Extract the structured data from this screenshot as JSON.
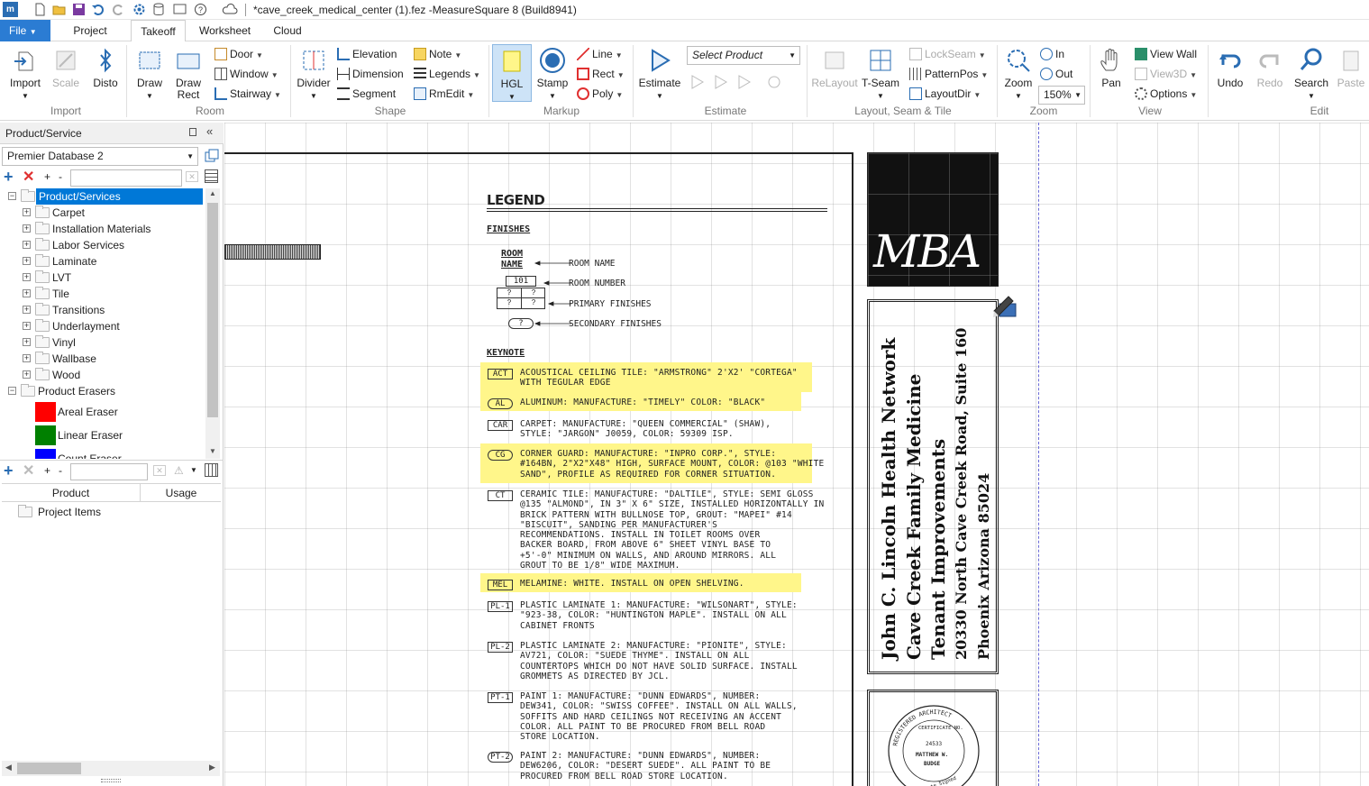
{
  "window": {
    "title": "*cave_creek_medical_center (1).fez -MeasureSquare 8 (Build8941)",
    "app_logo": "m"
  },
  "menu": {
    "file": "File",
    "tabs": [
      "Project Info",
      "Takeoff",
      "Worksheet",
      "Cloud"
    ],
    "active": "Takeoff"
  },
  "ribbon": {
    "import": {
      "import": "Import",
      "scale": "Scale",
      "disto": "Disto",
      "group": "Import"
    },
    "room": {
      "draw": "Draw",
      "draw_rect": "Draw Rect",
      "door": "Door",
      "window": "Window",
      "stairway": "Stairway",
      "group": "Room"
    },
    "shape": {
      "divider": "Divider",
      "elevation": "Elevation",
      "dimension": "Dimension",
      "segment": "Segment",
      "note": "Note",
      "legends": "Legends",
      "rmedit": "RmEdit",
      "group": "Shape"
    },
    "markup": {
      "hgl": "HGL",
      "stamp": "Stamp",
      "line": "Line",
      "rect": "Rect",
      "poly": "Poly",
      "group": "Markup"
    },
    "estimate": {
      "estimate": "Estimate",
      "select_product": "Select Product",
      "group": "Estimate"
    },
    "layout": {
      "relayout": "ReLayout",
      "tseam": "T-Seam",
      "lockseam": "LockSeam",
      "patternpos": "PatternPos",
      "layoutdir": "LayoutDir",
      "group": "Layout, Seam & Tile"
    },
    "zoom": {
      "zoom": "Zoom",
      "in": "In",
      "out": "Out",
      "level": "150%",
      "group": "Zoom"
    },
    "view": {
      "pan": "Pan",
      "view_wall": "View Wall",
      "view3d": "View3D",
      "options": "Options",
      "group": "View"
    },
    "edit": {
      "undo": "Undo",
      "redo": "Redo",
      "search": "Search",
      "paste": "Paste",
      "group": "Edit"
    }
  },
  "left_panel": {
    "title": "Product/Service",
    "database": "Premier Database 2",
    "tree_root": "Product/Services",
    "categories": [
      "Carpet",
      "Installation Materials",
      "Labor Services",
      "Laminate",
      "LVT",
      "Tile",
      "Transitions",
      "Underlayment",
      "Vinyl",
      "Wallbase",
      "Wood"
    ],
    "erasers_root": "Product Erasers",
    "erasers": [
      {
        "label": "Areal Eraser",
        "color": "#ff0000"
      },
      {
        "label": "Linear Eraser",
        "color": "#008000"
      },
      {
        "label": "Count Eraser",
        "color": "#0000ff"
      }
    ],
    "product_table": {
      "columns": [
        "Product",
        "Usage"
      ],
      "root": "Project Items"
    }
  },
  "drawing": {
    "legend_title": "LEGEND",
    "finishes_title": "FINISHES",
    "room_name_label": "ROOM\nNAME",
    "room_number_value": "101",
    "finish_placeholders": [
      "?",
      "?",
      "?",
      "?"
    ],
    "secondary_placeholder": "?",
    "callouts": [
      "ROOM NAME",
      "ROOM NUMBER",
      "PRIMARY FINISHES",
      "SECONDARY FINISHES"
    ],
    "keynote_title": "KEYNOTE",
    "keynotes": [
      {
        "tag": "ACT",
        "text": "ACOUSTICAL CEILING TILE: \"ARMSTRONG\" 2'X2' \"CORTEGA\"\nWITH TEGULAR EDGE",
        "highlight": true
      },
      {
        "tag": "AL",
        "text": "ALUMINUM: MANUFACTURE: \"TIMELY\" COLOR: \"BLACK\"",
        "highlight": true
      },
      {
        "tag": "CAR",
        "text": "CARPET: MANUFACTURE: \"QUEEN COMMERCIAL\" (SHAW),\nSTYLE: \"JARGON\" J0059, COLOR: 59309 ISP.",
        "highlight": false
      },
      {
        "tag": "CG",
        "text": "CORNER GUARD: MANUFACTURE: \"INPRO CORP.\", STYLE:\n#164BN, 2\"X2\"X48\" HIGH, SURFACE MOUNT, COLOR: @103 \"WHITE\nSAND\", PROFILE AS REQUIRED FOR CORNER SITUATION.",
        "highlight": true
      },
      {
        "tag": "CT",
        "text": "CERAMIC TILE: MANUFACTURE: \"DALTILE\", STYLE: SEMI GLOSS\n@135 \"ALMOND\", IN 3\" X 6\" SIZE, INSTALLED HORIZONTALLY IN\nBRICK PATTERN WITH BULLNOSE TOP, GROUT: \"MAPEI\" #14\n\"BISCUIT\", SANDING PER MANUFACTURER'S\nRECOMMENDATIONS. INSTALL IN TOILET ROOMS OVER\nBACKER BOARD, FROM ABOVE 6\" SHEET VINYL BASE TO\n+5'-0\" MINIMUM ON WALLS, AND AROUND MIRRORS. ALL\nGROUT TO BE 1/8\" WIDE MAXIMUM.",
        "highlight": false
      },
      {
        "tag": "MEL",
        "text": "MELAMINE: WHITE. INSTALL ON OPEN SHELVING.",
        "highlight": true
      },
      {
        "tag": "PL-1",
        "text": "PLASTIC LAMINATE 1: MANUFACTURE: \"WILSONART\", STYLE:\n\"923-38, COLOR: \"HUNTINGTON MAPLE\". INSTALL ON ALL\nCABINET FRONTS",
        "highlight": false
      },
      {
        "tag": "PL-2",
        "text": "PLASTIC LAMINATE 2: MANUFACTURE: \"PIONITE\", STYLE:\nAV721, COLOR: \"SUEDE THYME\". INSTALL ON ALL\nCOUNTERTOPS WHICH DO NOT HAVE SOLID SURFACE. INSTALL\nGROMMETS AS DIRECTED BY JCL.",
        "highlight": false
      },
      {
        "tag": "PT-1",
        "text": "PAINT 1: MANUFACTURE: \"DUNN EDWARDS\", NUMBER:\nDEW341, COLOR: \"SWISS COFFEE\". INSTALL ON ALL WALLS,\nSOFFITS AND HARD CEILINGS NOT RECEIVING AN ACCENT\nCOLOR. ALL PAINT TO BE PROCURED FROM BELL ROAD\nSTORE LOCATION.",
        "highlight": false
      },
      {
        "tag": "PT-2",
        "text": "PAINT 2: MANUFACTURE: \"DUNN EDWARDS\", NUMBER:\nDEW6206, COLOR: \"DESERT SUEDE\". ALL PAINT TO BE\nPROCURED FROM BELL ROAD STORE LOCATION.",
        "highlight": false
      }
    ],
    "logo_text": "MBA",
    "project_lines": [
      "John C. Lincoln Health Network",
      "Cave Creek Family Medicine",
      "Tenant Improvements",
      "20330 North Cave Creek Road, Suite 160",
      "Phoenix Arizona 85024"
    ],
    "seal": {
      "ring": "REGISTERED ARCHITECT",
      "cert_label": "CERTIFICATE NO.",
      "cert_no": "24533",
      "name1": "MATTHEW W.",
      "name2": "BUDGE",
      "date_label": "Date Signed"
    }
  }
}
